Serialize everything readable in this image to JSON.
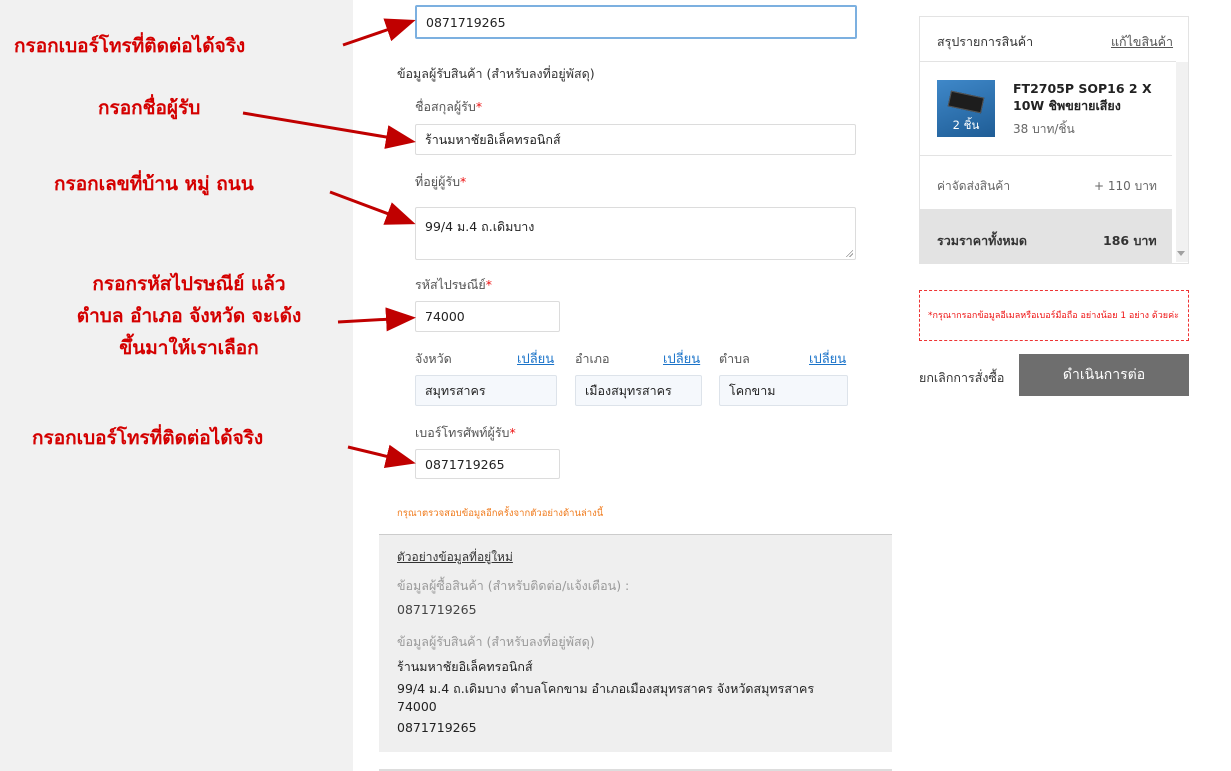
{
  "form": {
    "phone_top_value": "0871719265",
    "recipient_section_title": "ข้อมูลผู้รับสินค้า (สำหรับลงที่อยู่พัสดุ)",
    "name_label": "ชื่อสกุลผู้รับ",
    "name_value": "ร้านมหาชัยอิเล็คทรอนิกส์",
    "address_label": "ที่อยู่ผู้รับ",
    "address_value": "99/4 ม.4 ถ.เดิมบาง",
    "postcode_label": "รหัสไปรษณีย์",
    "postcode_value": "74000",
    "province_label": "จังหวัด",
    "district_label": "อำเภอ",
    "subdistrict_label": "ตำบล",
    "change_label": "เปลี่ยน",
    "province_value": "สมุทรสาคร",
    "district_value": "เมืองสมุทรสาคร",
    "subdistrict_value": "โคกขาม",
    "phone_label": "เบอร์โทรศัพท์ผู้รับ",
    "phone_value": "0871719265",
    "required_mark": "*",
    "check_note": "กรุณาตรวจสอบข้อมูลอีกครั้งจากตัวอย่างด้านล่างนี้"
  },
  "example": {
    "title": "ตัวอย่างข้อมูลที่อยู่ใหม่",
    "buyer_label": "ข้อมูลผู้ซื้อสินค้า (สำหรับติดต่อ/แจ้งเตือน) :",
    "buyer_phone": "0871719265",
    "recipient_label": "ข้อมูลผู้รับสินค้า (สำหรับลงที่อยู่พัสดุ)",
    "line_name": "ร้านมหาชัยอิเล็คทรอนิกส์",
    "line_address": "99/4 ม.4 ถ.เดิมบาง ตำบลโคกขาม อำเภอเมืองสมุทรสาคร จังหวัดสมุทรสาคร",
    "line_postcode": "74000",
    "line_phone": "0871719265"
  },
  "summary": {
    "title": "สรุปรายการสินค้า",
    "edit_link": "แก้ไขสินค้า",
    "product_name": "FT2705P SOP16 2 X 10W ชิพขยายเสียง",
    "product_qty": "2 ชิ้น",
    "product_price": "38 บาท/ชิ้น",
    "shipping_label": "ค่าจัดส่งสินค้า",
    "shipping_value": "+ 110 บาท",
    "total_label": "รวมราคาทั้งหมด",
    "total_value": "186 บาท",
    "warning": "*กรุณากรอกข้อมูลอีเมลหรือเบอร์มือถือ อย่างน้อย 1 อย่าง ด้วยค่ะ",
    "cancel_label": "ยกเลิกการสั่งซื้อ",
    "continue_label": "ดำเนินการต่อ"
  },
  "annotations": {
    "phone_top": "กรอกเบอร์โทรที่ติดต่อได้จริง",
    "name": "กรอกชื่อผู้รับ",
    "address": "กรอกเลขที่บ้าน หมู่ ถนน",
    "postcode_line1": "กรอกรหัสไปรษณีย์ แล้ว",
    "postcode_line2": "ตำบล อำเภอ จังหวัด จะเด้ง",
    "postcode_line3": "ขึ้นมาให้เราเลือก",
    "phone_bottom": "กรอกเบอร์โทรที่ติดต่อได้จริง"
  },
  "colors": {
    "annotation": "#d40000",
    "link": "#1a73c9",
    "note": "#f07b1d",
    "button": "#6e6e6e"
  }
}
